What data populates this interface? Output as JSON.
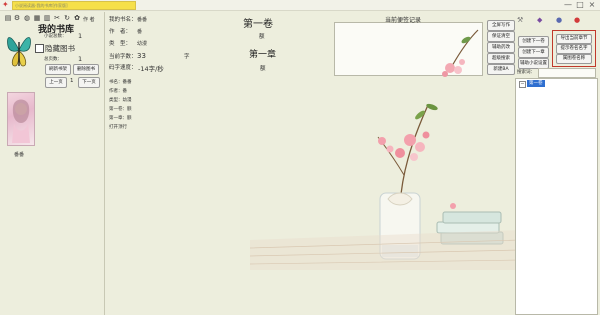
{
  "window": {
    "title": "小说阅读器-我的书库[作家版]",
    "minimize": "—",
    "maximize": "□",
    "close": "×"
  },
  "toolbar": {
    "author_label": "作 者"
  },
  "library": {
    "title": "我的书库",
    "count_label": "小说总数：",
    "count": "1",
    "hide_checkbox": "隐藏图书",
    "sort_label": "总页数：",
    "sort_value": "1",
    "btn_refresh": "刷新书架",
    "btn_delete": "删除图书",
    "prev_page": "上一页",
    "page_num": "1",
    "next_page": "下一页",
    "book_name": "番番"
  },
  "info": {
    "book_label": "我的书名：",
    "book_value": "番番",
    "author_label": "作　者：",
    "author_value": "番",
    "type_label": "类　型：",
    "type_value": "幼漫",
    "words_label": "当前字数：",
    "words_value": "33",
    "words_unit": "字",
    "speed_label": "码字速度：",
    "speed_value": "-14字/秒"
  },
  "tree": [
    "书名：番番",
    "作者：番",
    "类型：幼漫",
    "第一卷：额",
    "第一章：额",
    "打开顶行"
  ],
  "editor": {
    "volume": "第一卷",
    "volume_sub": "额",
    "chapter": "第一章",
    "chapter_sub": "额",
    "notes_title": "当前便签记录"
  },
  "buttons_col1": [
    "全屏写作",
    "保证清空",
    "辅助药改",
    "超级搜索",
    "新建BA"
  ],
  "buttons_col2": [
    "创建下一卷",
    "创建下一章",
    "辅助小说设置"
  ],
  "buttons_col3": [
    "导出当前章节",
    "提示卷名名字",
    "属图卷名称"
  ],
  "search": {
    "label": "搜索词：",
    "tree_item": "第一卷"
  },
  "colors": {
    "accent": "#d23b3b",
    "highlight_border": "#c0392b",
    "title_bar": "#f6e04a"
  }
}
